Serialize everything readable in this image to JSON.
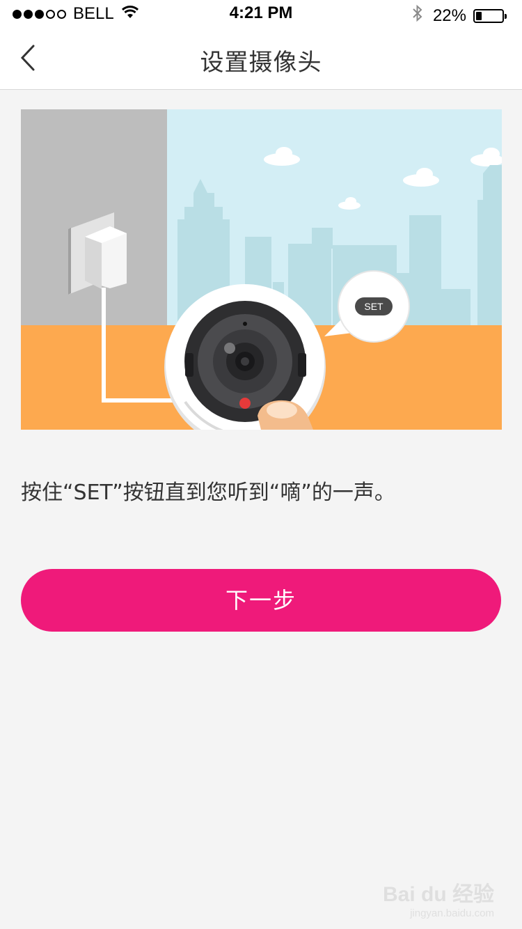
{
  "status_bar": {
    "carrier": "BELL",
    "time": "4:21 PM",
    "battery": "22%",
    "battery_level": 0.22,
    "signal_bars_filled": 3,
    "signal_bars_total": 5
  },
  "nav": {
    "title": "设置摄像头",
    "back_icon": "chevron-left-icon"
  },
  "illustration": {
    "set_label": "SET"
  },
  "content": {
    "instruction": "按住“SET”按钮直到您听到“嘀”的一声。"
  },
  "actions": {
    "next_label": "下一步"
  },
  "watermark": {
    "logo": "Bai du 经验",
    "url": "jingyan.baidu.com"
  },
  "colors": {
    "accent": "#ef1a7a",
    "floor": "#fda94f",
    "sky": "#d3eef5",
    "wall": "#bdbdbd"
  }
}
